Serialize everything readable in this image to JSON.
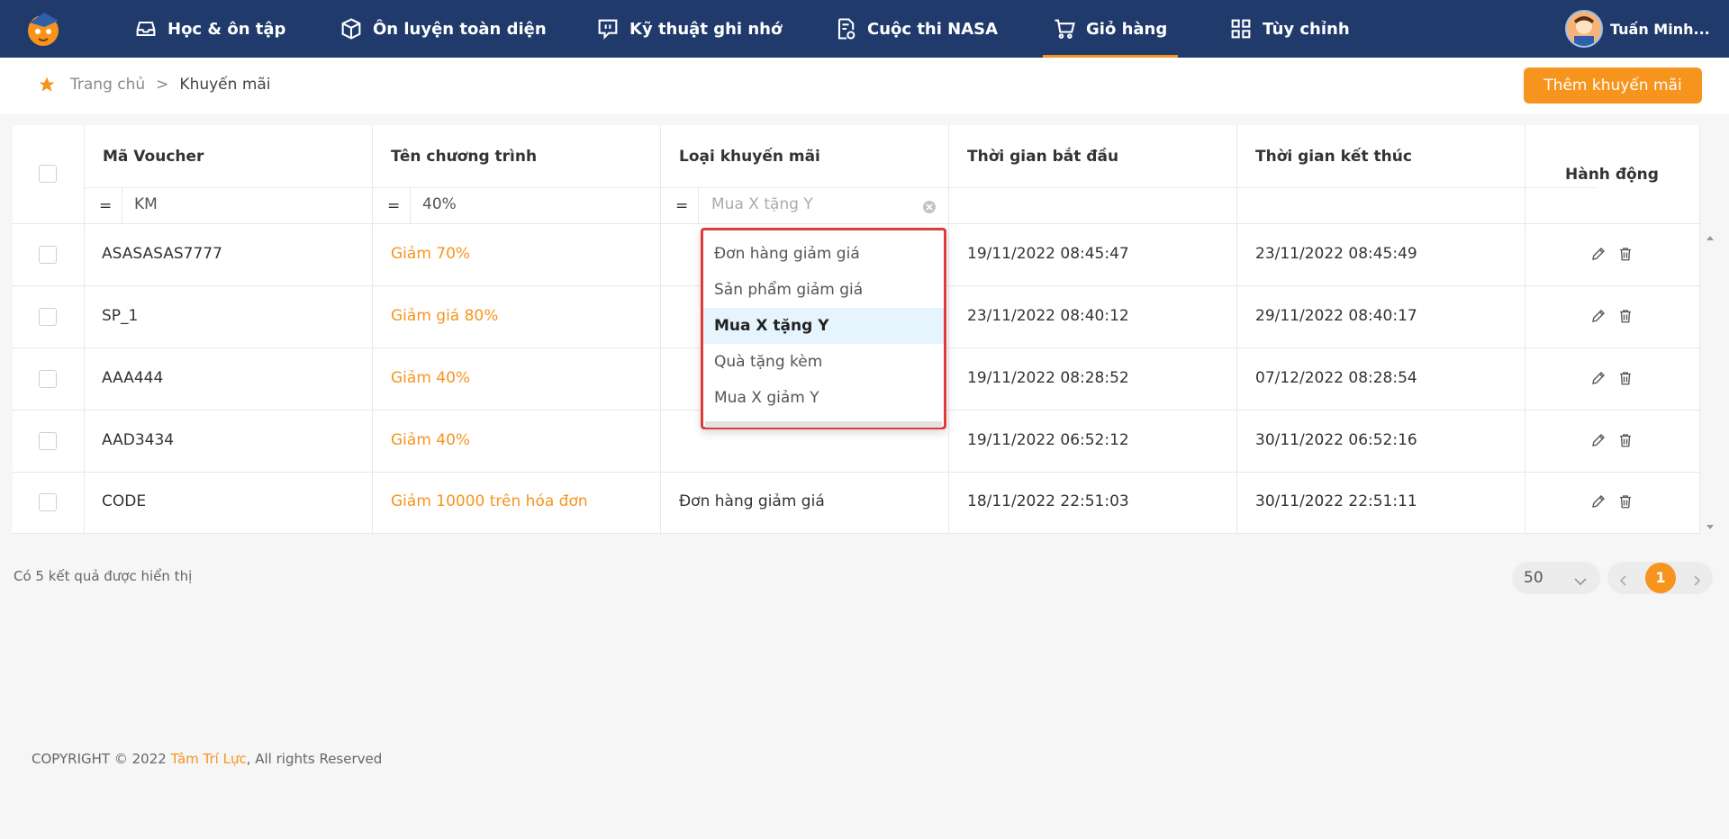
{
  "nav": {
    "items": [
      {
        "label": "Học & ôn tập",
        "icon": "inbox-icon"
      },
      {
        "label": "Ôn luyện toàn diện",
        "icon": "cube-icon"
      },
      {
        "label": "Kỹ thuật ghi nhớ",
        "icon": "chat-bubble-icon"
      },
      {
        "label": "Cuộc thi NASA",
        "icon": "document-gear-icon"
      },
      {
        "label": "Giỏ hàng",
        "icon": "cart-icon",
        "active": true
      },
      {
        "label": "Tùy chỉnh",
        "icon": "grid-icon"
      }
    ],
    "user_name": "Tuấn Minh..."
  },
  "breadcrumb": {
    "home": "Trang chủ",
    "separator": ">",
    "current": "Khuyến mãi"
  },
  "add_button": "Thêm khuyến mãi",
  "table": {
    "columns": [
      "Mã Voucher",
      "Tên chương trình",
      "Loại khuyến mãi",
      "Thời gian bắt đầu",
      "Thời gian kết thúc",
      "Hành động"
    ],
    "filters": {
      "op": "=",
      "voucher": "KM",
      "name": "40%",
      "type_placeholder": "Mua X tặng Y"
    },
    "rows": [
      {
        "code": "ASASASAS7777",
        "name": "Giảm 70%",
        "type": "",
        "start": "19/11/2022 08:45:47",
        "end": "23/11/2022 08:45:49"
      },
      {
        "code": "SP_1",
        "name": "Giảm giá 80%",
        "type": "",
        "start": "23/11/2022 08:40:12",
        "end": "29/11/2022 08:40:17"
      },
      {
        "code": "AAA444",
        "name": "Giảm 40%",
        "type": "",
        "start": "19/11/2022 08:28:52",
        "end": "07/12/2022 08:28:54"
      },
      {
        "code": "AAD3434",
        "name": "Giảm 40%",
        "type": "",
        "start": "19/11/2022 06:52:12",
        "end": "30/11/2022 06:52:16"
      },
      {
        "code": "CODE",
        "name": "Giảm 10000 trên hóa đơn",
        "type": "Đơn hàng giảm giá",
        "start": "18/11/2022 22:51:03",
        "end": "30/11/2022 22:51:11"
      }
    ]
  },
  "dropdown": {
    "options": [
      "Đơn hàng giảm giá",
      "Sản phẩm giảm giá",
      "Mua X tặng Y",
      "Quà tặng kèm",
      "Mua X giảm Y"
    ],
    "selected": "Mua X tặng Y"
  },
  "footer": {
    "count": "Có 5 kết quả được hiển thị",
    "page_size": "50",
    "current_page": "1",
    "copyright_prefix": "COPYRIGHT © 2022 ",
    "brand": "Tâm Trí Lực",
    "copyright_suffix": ", All rights Reserved"
  },
  "colors": {
    "nav_bg": "#1f3a6b",
    "accent": "#f7941d",
    "dropdown_border": "#e03a3a",
    "selected_option_bg": "#e6f5fd"
  }
}
